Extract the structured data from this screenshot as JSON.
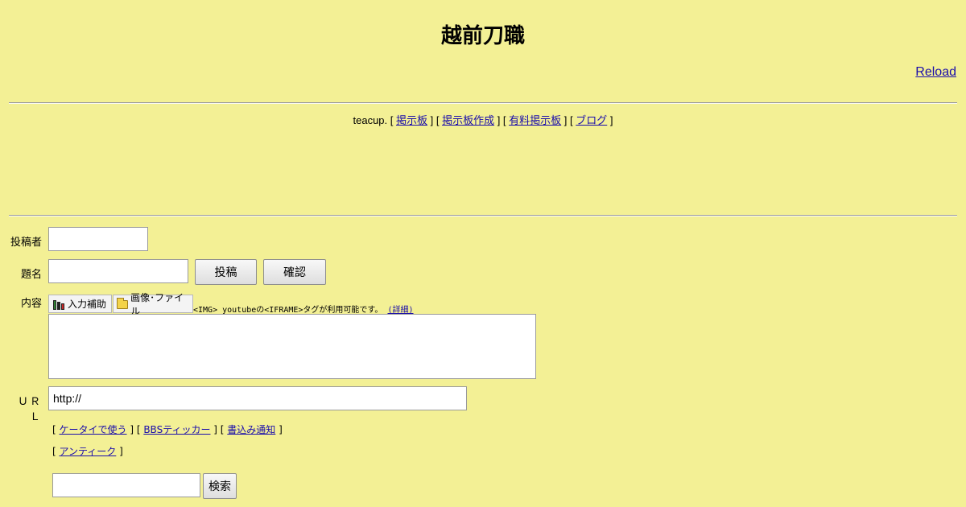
{
  "title": "越前刀職",
  "reload_label": "Reload",
  "nav": {
    "brand": "teacup.",
    "links": [
      "掲示板",
      "掲示板作成",
      "有料掲示板",
      "ブログ"
    ]
  },
  "form": {
    "author_label": "投稿者",
    "subject_label": "題名",
    "content_label": "内容",
    "url_label": "ＵＲＬ",
    "url_value": "http://",
    "post_button": "投稿",
    "confirm_button": "確認",
    "assist_button": "入力補助",
    "image_button": "画像･ファイル",
    "hint_text": "<IMG> youtubeの<IFRAME>タグが利用可能です。",
    "hint_link": "(詳細)"
  },
  "links_row1": [
    "ケータイで使う",
    "BBSティッカー",
    "書込み通知"
  ],
  "links_row2": [
    "アンティーク"
  ],
  "search": {
    "button": "検索"
  },
  "colors": {
    "background": "#f3f095",
    "link": "#1a0dab"
  }
}
